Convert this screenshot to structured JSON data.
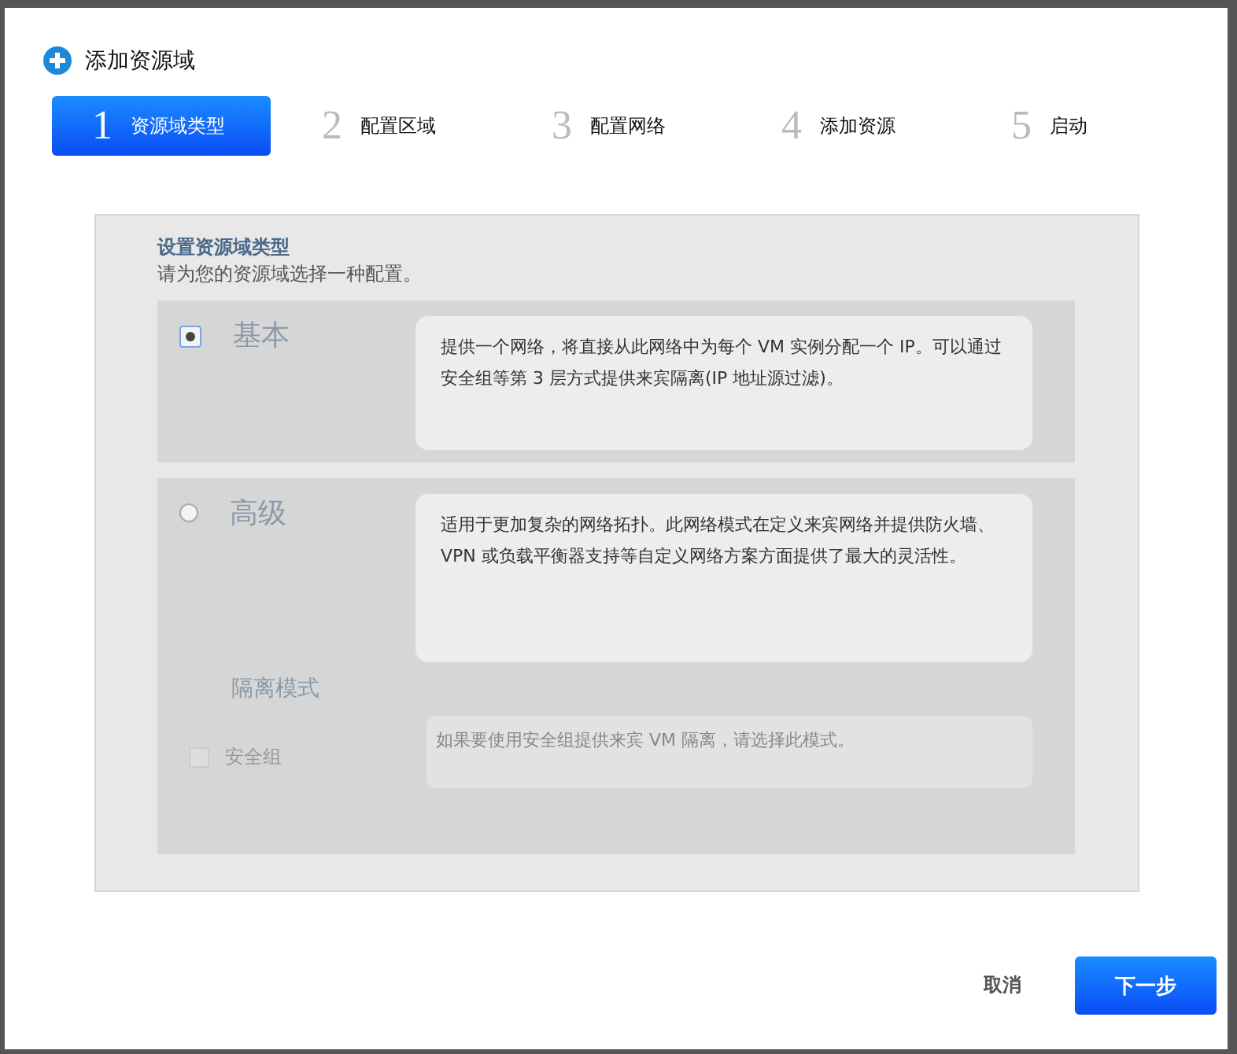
{
  "dialog": {
    "title": "添加资源域"
  },
  "steps": [
    {
      "number": "1",
      "label": "资源域类型",
      "selected": true
    },
    {
      "number": "2",
      "label": "配置区域",
      "selected": false
    },
    {
      "number": "3",
      "label": "配置网络",
      "selected": false
    },
    {
      "number": "4",
      "label": "添加资源",
      "selected": false
    },
    {
      "number": "5",
      "label": "启动",
      "selected": false
    }
  ],
  "section": {
    "title": "设置资源域类型",
    "subtitle": "请为您的资源域选择一种配置。"
  },
  "options": [
    {
      "label": "基本",
      "selected": true,
      "description": "提供一个网络，将直接从此网络中为每个 VM 实例分配一个 IP。可以通过安全组等第 3 层方式提供来宾隔离(IP 地址源过滤)。"
    },
    {
      "label": "高级",
      "selected": false,
      "description": "适用于更加复杂的网络拓扑。此网络模式在定义来宾网络并提供防火墙、VPN 或负载平衡器支持等自定义网络方案方面提供了最大的灵活性。",
      "isolation": {
        "title": "隔离模式",
        "checkbox": {
          "label": "安全组",
          "checked": false,
          "disabled": true
        },
        "description": "如果要使用安全组提供来宾 VM 隔离，请选择此模式。"
      }
    }
  ],
  "buttons": [
    {
      "label": "取消",
      "kind": "secondary"
    },
    {
      "label": "下一步",
      "kind": "primary"
    }
  ]
}
